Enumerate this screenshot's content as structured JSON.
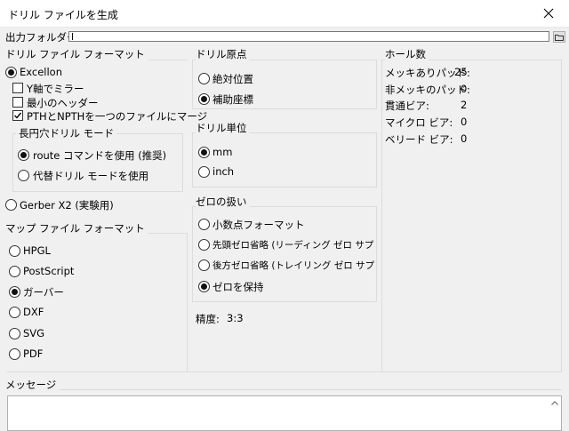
{
  "window": {
    "title": "ドリル ファイルを生成"
  },
  "output": {
    "label": "出力フォルダー:",
    "value": ""
  },
  "drill_format": {
    "header": "ドリル ファイル フォーマット",
    "excellon_label": "Excellon",
    "options": [
      {
        "label": "Y軸でミラー",
        "checked": false
      },
      {
        "label": "最小のヘッダー",
        "checked": false
      },
      {
        "label": "PTHとNPTHを一つのファイルにマージ",
        "checked": true
      }
    ],
    "oval_header": "長円穴ドリル モード",
    "oval_options": [
      {
        "label": "route コマンドを使用 (推奨)",
        "selected": true
      },
      {
        "label": "代替ドリル モードを使用",
        "selected": false
      }
    ],
    "gerber_label": "Gerber X2 (実験用)"
  },
  "map_format": {
    "header": "マップ ファイル フォーマット",
    "options": [
      {
        "label": "HPGL",
        "selected": false
      },
      {
        "label": "PostScript",
        "selected": false
      },
      {
        "label": "ガーバー",
        "selected": true
      },
      {
        "label": "DXF",
        "selected": false
      },
      {
        "label": "SVG",
        "selected": false
      },
      {
        "label": "PDF",
        "selected": false
      }
    ]
  },
  "origin": {
    "header": "ドリル原点",
    "options": [
      {
        "label": "絶対位置",
        "selected": false
      },
      {
        "label": "補助座標",
        "selected": true
      }
    ]
  },
  "units": {
    "header": "ドリル単位",
    "options": [
      {
        "label": "mm",
        "selected": true
      },
      {
        "label": "inch",
        "selected": false
      }
    ]
  },
  "zeros": {
    "header": "ゼロの扱い",
    "options": [
      {
        "label": "小数点フォーマット",
        "selected": false
      },
      {
        "label": "先頭ゼロ省略 (リーディング ゼロ サプレス",
        "selected": false
      },
      {
        "label": "後方ゼロ省略 (トレイリング ゼロ サプレス",
        "selected": false
      },
      {
        "label": "ゼロを保持",
        "selected": true
      }
    ]
  },
  "precision": {
    "label": "精度:",
    "value": "3:3"
  },
  "holes": {
    "header": "ホール数",
    "rows": [
      {
        "label": "メッキありパッド:",
        "value": "25"
      },
      {
        "label": "非メッキのパッド:",
        "value": "0"
      },
      {
        "label": "貫通ビア:",
        "value": "2"
      },
      {
        "label": "マイクロ ビア:",
        "value": "0"
      },
      {
        "label": "ベリード ビア:",
        "value": "0"
      }
    ]
  },
  "messages": {
    "header": "メッセージ"
  }
}
